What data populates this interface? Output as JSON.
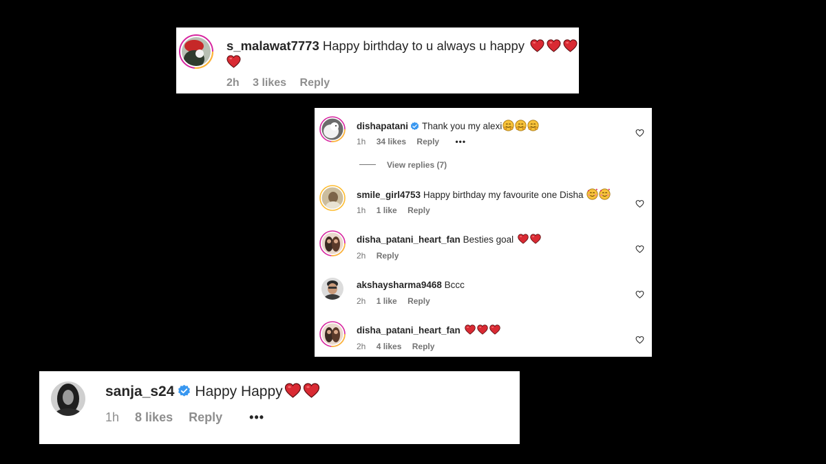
{
  "comment_top": {
    "username": "s_malawat7773",
    "text": "Happy birthday to u always u happy",
    "time": "2h",
    "likes": "3 likes",
    "reply": "Reply"
  },
  "thread": {
    "main": {
      "username": "dishapatani",
      "text": "Thank you my alexi",
      "time": "1h",
      "likes": "34 likes",
      "reply": "Reply",
      "more": "•••"
    },
    "view_replies": "View replies (7)",
    "replies": [
      {
        "username": "smile_girl4753",
        "text": "Happy birthday my favourite one Disha",
        "time": "1h",
        "likes": "1 like",
        "reply": "Reply"
      },
      {
        "username": "disha_patani_heart_fan",
        "text": "Besties goal",
        "time": "2h",
        "reply": "Reply"
      },
      {
        "username": "akshaysharma9468",
        "text": "Bccc",
        "time": "2h",
        "likes": "1 like",
        "reply": "Reply"
      },
      {
        "username": "disha_patani_heart_fan",
        "text": "",
        "time": "2h",
        "likes": "4 likes",
        "reply": "Reply"
      }
    ]
  },
  "comment_bottom": {
    "username": "sanja_s24",
    "text": "Happy Happy",
    "time": "1h",
    "likes": "8 likes",
    "reply": "Reply",
    "more": "•••"
  },
  "icons": {
    "heart_emoji": "red-heart-icon",
    "hug_emoji": "hugging-face-icon",
    "love_emoji": "smiling-face-with-hearts-icon",
    "verified": "verified-badge-icon",
    "like": "heart-outline-icon"
  },
  "colors": {
    "background": "#000000",
    "card": "#ffffff",
    "heart_red": "#e0245e",
    "verified_blue": "#3897f0",
    "meta_grey": "#737373"
  }
}
